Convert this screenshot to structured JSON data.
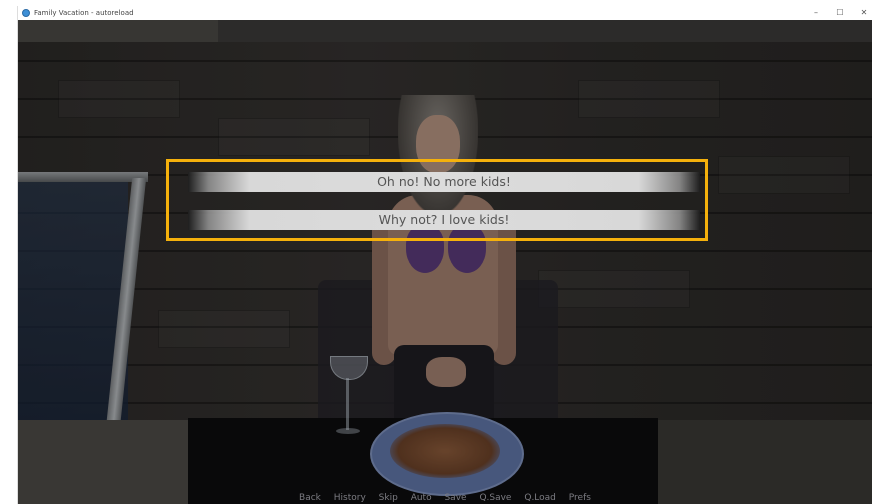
{
  "window": {
    "title": "Family Vacation - autoreload",
    "controls": {
      "minimize": "–",
      "maximize": "☐",
      "close": "✕"
    },
    "icon": "app-icon"
  },
  "choices": [
    {
      "label": "Oh no! No more kids!"
    },
    {
      "label": "Why not? I love kids!"
    }
  ],
  "highlight_color": "#f5b10c",
  "quick_menu": [
    "Back",
    "History",
    "Skip",
    "Auto",
    "Save",
    "Q.Save",
    "Q.Load",
    "Prefs"
  ]
}
